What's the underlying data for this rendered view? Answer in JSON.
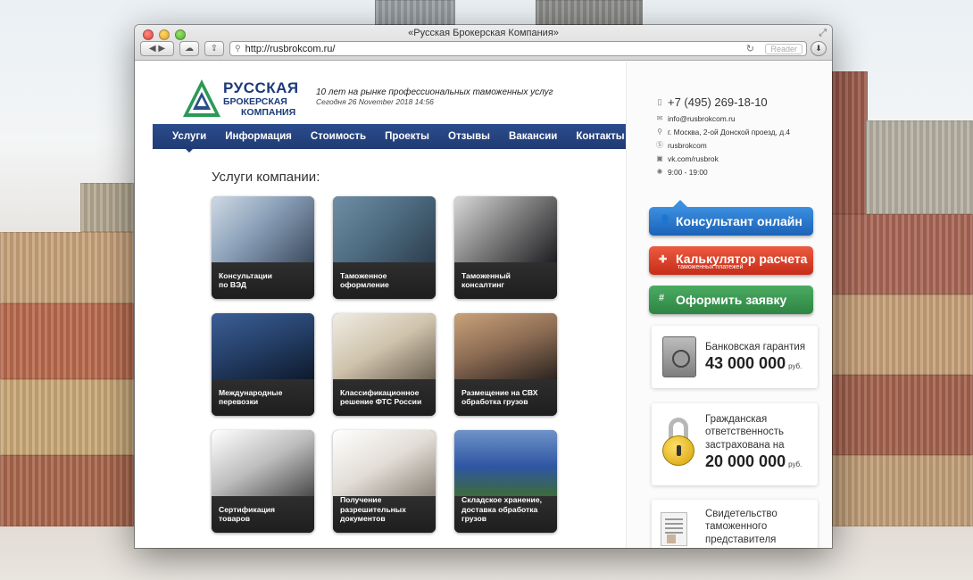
{
  "window": {
    "title": "«Русская Брокерская Компания»",
    "url": "http://rusbrokcom.ru/",
    "reader_label": "Reader"
  },
  "header": {
    "logo_line1": "РУССКАЯ",
    "logo_line2": "БРОКЕРСКАЯ",
    "logo_line3": "КОМПАНИЯ",
    "tagline": "10 лет на рынке профессиональных таможенных услуг",
    "date": "Сегодня 26 November 2018 14:56"
  },
  "nav": {
    "items": [
      "Услуги",
      "Информация",
      "Стоимость",
      "Проекты",
      "Отзывы",
      "Вакансии",
      "Контакты"
    ],
    "active_index": 0
  },
  "services": {
    "title": "Услуги компании:",
    "tiles": [
      {
        "lines": [
          "Консультации",
          "по ВЭД"
        ]
      },
      {
        "lines": [
          "Таможенное",
          "оформление"
        ]
      },
      {
        "lines": [
          "Таможенный",
          "консалтинг"
        ]
      },
      {
        "lines": [
          "Международные",
          "перевозки"
        ]
      },
      {
        "lines": [
          "Классификационное",
          "решение ФТС России"
        ]
      },
      {
        "lines": [
          "Размещение на СВХ",
          "обработка грузов"
        ]
      },
      {
        "lines": [
          "Сертификация",
          "товаров"
        ]
      },
      {
        "lines": [
          "Получение",
          "разрешительных",
          "документов"
        ]
      },
      {
        "lines": [
          "Складское хранение,",
          "доставка обработка",
          "грузов"
        ]
      }
    ]
  },
  "contacts": {
    "phone": "+7 (495) 269-18-10",
    "email": "info@rusbrokcom.ru",
    "address": "г. Москва, 2-ой Донской проезд, д.4",
    "skype": "rusbrokcom",
    "vk": "vk.com/rusbrok",
    "hours": "9:00 - 19:00"
  },
  "actions": {
    "consultant": "Консультант онлайн",
    "calculator": "Калькулятор расчета",
    "calculator_sub": "таможенных платежей",
    "order": "Оформить заявку"
  },
  "cards": {
    "guarantee_label": "Банковская гарантия",
    "guarantee_amount": "43 000 000",
    "currency": "руб.",
    "insurance_line1": "Гражданская",
    "insurance_line2": "ответственность",
    "insurance_line3": "застрахована на",
    "insurance_amount": "20 000 000",
    "certificate_line1": "Свидетельство",
    "certificate_line2": "таможенного",
    "certificate_line3": "представителя"
  },
  "colors": {
    "nav_blue": "#1f3b74",
    "consultant_blue": "#1b63b7",
    "calculator_red": "#c62c19",
    "order_green": "#2d8543"
  }
}
